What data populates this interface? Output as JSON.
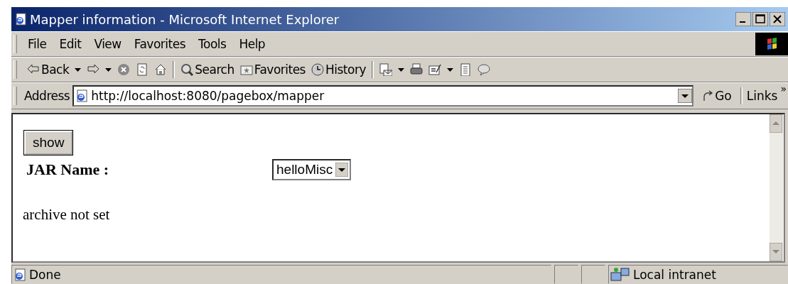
{
  "window": {
    "title": "Mapper information - Microsoft Internet Explorer"
  },
  "menu": [
    "File",
    "Edit",
    "View",
    "Favorites",
    "Tools",
    "Help"
  ],
  "toolbar": [
    {
      "kind": "back",
      "label": "Back",
      "dropdown": true
    },
    {
      "kind": "forward",
      "dropdown": true
    },
    {
      "kind": "stop"
    },
    {
      "kind": "refresh"
    },
    {
      "kind": "home"
    },
    {
      "kind": "separator"
    },
    {
      "kind": "search",
      "label": "Search"
    },
    {
      "kind": "favorites",
      "label": "Favorites"
    },
    {
      "kind": "history",
      "label": "History"
    },
    {
      "kind": "separator"
    },
    {
      "kind": "mail",
      "dropdown": true
    },
    {
      "kind": "print"
    },
    {
      "kind": "edit",
      "dropdown": true
    },
    {
      "kind": "discuss"
    },
    {
      "kind": "messenger"
    }
  ],
  "address": {
    "label": "Address",
    "value": "http://localhost:8080/pagebox/mapper",
    "go": "Go",
    "links": "Links",
    "more": "»"
  },
  "content": {
    "button": "show",
    "field_label": "JAR Name :",
    "select_value": "helloMisc",
    "message": "archive not set"
  },
  "status_bar": {
    "text": "Done",
    "zone": "Local intranet"
  }
}
